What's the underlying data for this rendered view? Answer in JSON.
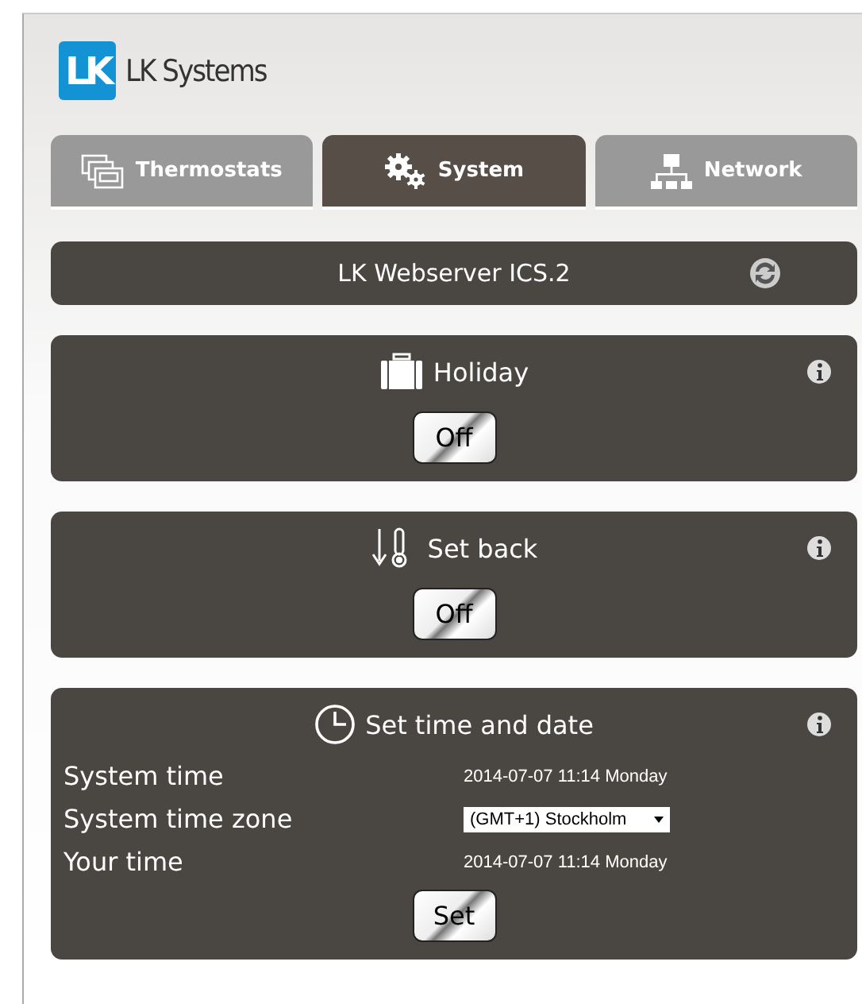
{
  "brand": {
    "logo": "LK",
    "name": "LK Systems"
  },
  "tabs": [
    {
      "label": "Thermostats",
      "selected": false
    },
    {
      "label": "System",
      "selected": true
    },
    {
      "label": "Network",
      "selected": false
    }
  ],
  "header": {
    "title": "LK Webserver ICS.2"
  },
  "panels": [
    {
      "kind": "toggle",
      "title": "Holiday",
      "button": "Off"
    },
    {
      "kind": "toggle",
      "title": "Set back",
      "button": "Off"
    },
    {
      "kind": "time",
      "title": "Set time and date",
      "rows": [
        {
          "label": "System time",
          "kind": "text",
          "value": "2014-07-07 11:14 Monday"
        },
        {
          "label": "System time zone",
          "kind": "select",
          "value": "(GMT+1) Stockholm"
        },
        {
          "label": "Your time",
          "kind": "text",
          "value": "2014-07-07 11:14 Monday"
        }
      ],
      "button": "Set"
    }
  ]
}
